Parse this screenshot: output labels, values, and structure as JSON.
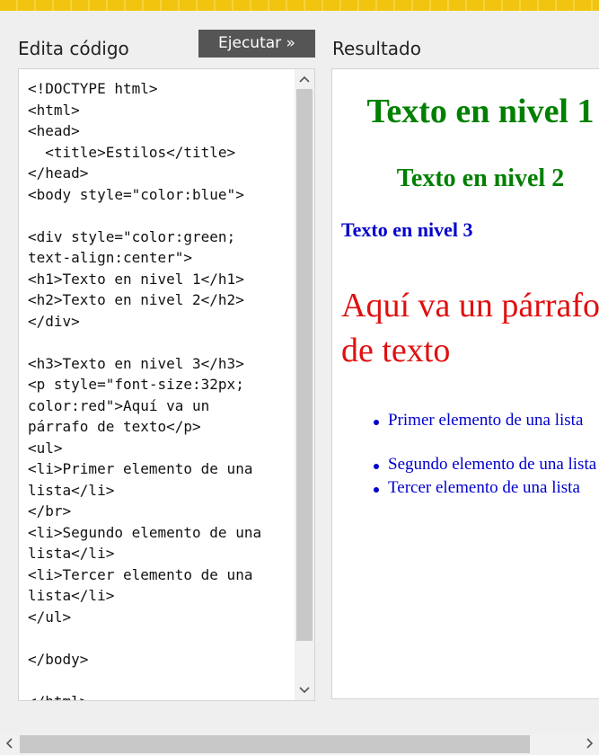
{
  "labels": {
    "editor": "Edita código",
    "result": "Resultado"
  },
  "run_button": "Ejecutar »",
  "code": "<!DOCTYPE html>\n<html>\n<head>\n  <title>Estilos</title>\n</head>\n<body style=\"color:blue\">\n\n<div style=\"color:green;\ntext-align:center\">\n<h1>Texto en nivel 1</h1>\n<h2>Texto en nivel 2</h2>\n</div>\n\n<h3>Texto en nivel 3</h3>\n<p style=\"font-size:32px;\ncolor:red\">Aquí va un\npárrafo de texto</p>\n<ul>\n<li>Primer elemento de una\nlista</li>\n</br>\n<li>Segundo elemento de una\nlista</li>\n<li>Tercer elemento de una\nlista</li>\n</ul>\n\n</body>\n\n</html>",
  "result": {
    "heading1": "Texto en nivel 1",
    "heading2": "Texto en nivel 2",
    "heading3": "Texto en nivel 3",
    "paragraph": "Aquí va un párrafo de texto",
    "list_items": [
      "Primer elemento de una lista",
      "Segundo elemento de una lista",
      "Tercer elemento de una lista"
    ]
  },
  "colors": {
    "heading_green": "#008000",
    "body_blue": "#0000cc",
    "paragraph_red": "#e01010",
    "button_bg": "#555555",
    "top_strip": "#f1c40f"
  },
  "icons": {
    "scroll_up": "chevron-up-icon",
    "scroll_down": "chevron-down-icon",
    "scroll_left": "chevron-left-icon",
    "scroll_right": "chevron-right-icon"
  }
}
